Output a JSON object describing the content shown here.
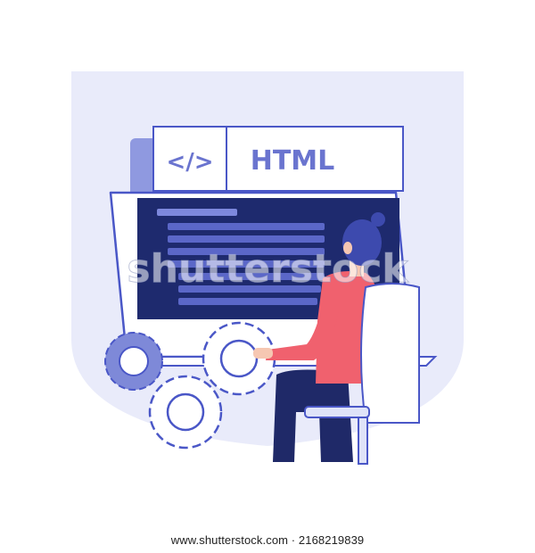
{
  "tags": {
    "code_symbol": "</>",
    "language_label": "HTML"
  },
  "watermark": {
    "text": "shutterstock"
  },
  "footer": {
    "credit": "www.shutterstock.com · 2168219839"
  },
  "colors": {
    "backdrop": "#e9ebfa",
    "screen_dark": "#1e2a6e",
    "code_line": "#5b67c8",
    "code_line_accent": "#7d88dd",
    "accent_blue": "#4a57c7",
    "label_text": "#6a74cf",
    "shirt": "#f0616e",
    "pants": "#1f2968",
    "gear_blue": "#7e89d8"
  }
}
